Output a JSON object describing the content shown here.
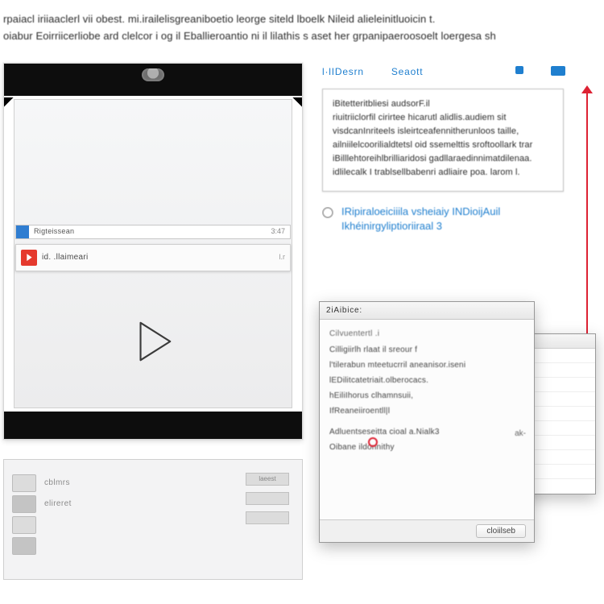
{
  "header": {
    "line1": "rpaiacl iriiaaclerl vii obest. mi.irailelisgreaniboetio leorge siteld lboelk Nileid alieleinitluoicin t.",
    "line2": "oiabur Eoirriicerliobe ard clelcor i og il Eballieroantio ni il lilathis s aset her grpanipaeroosoelt loergesa sh"
  },
  "video": {
    "track_label": "Rigteissean",
    "track_time": "3:47",
    "media_label": "id. .llaimeari",
    "media_right": "l.r"
  },
  "tabs": {
    "t1": "l·lIDesrn",
    "t2": "Seaott"
  },
  "desc": {
    "l1": "iBitetteritbliesi audsorF.il",
    "l2": "riuitriiclorfil cirirtee  hicarutl alidlis.audiem sit",
    "l3": "visdcanInriteels  isleirtceafennitherunloos taille,",
    "l4": "ailniilelcoorilialdtetsl oid ssemelttis sroftoollark trar",
    "l5": "iBilllehtoreihlbrilliaridosi gadllaraedinnimatdilenaa.",
    "l6": "idlilecalk I trablsellbabenri adliaire poa. larom l."
  },
  "source": {
    "line1": "IRipiraloeiciiila vsheiaiy INDioijAuil",
    "line2": "Ikhéinirgyliptioriiraal  3"
  },
  "window": {
    "title": "2iAibice:",
    "heading": "Cilvuentertl   .i",
    "items": [
      "Cilligiirlh  rlaat il sreour f",
      "l'tilerabun  mteetucrril aneanisor.iseni",
      "lEDilitcatetriait.olberocacs.",
      "hEiliIhorus clhamnsuii,",
      "IfReaneiiroentll|l"
    ],
    "section_label": "Adluentseseitta cioal a.Nialk3",
    "section_item": "Oibane ildonnithy",
    "corner_label": "ak-",
    "footer_button": "cloiilseb"
  },
  "bottom_card": {
    "rows": [
      "cblmrs",
      "elireret",
      "",
      ""
    ],
    "badges": [
      "laeest",
      "",
      ""
    ]
  },
  "icons": {
    "play": "play",
    "knob": "webcam"
  }
}
